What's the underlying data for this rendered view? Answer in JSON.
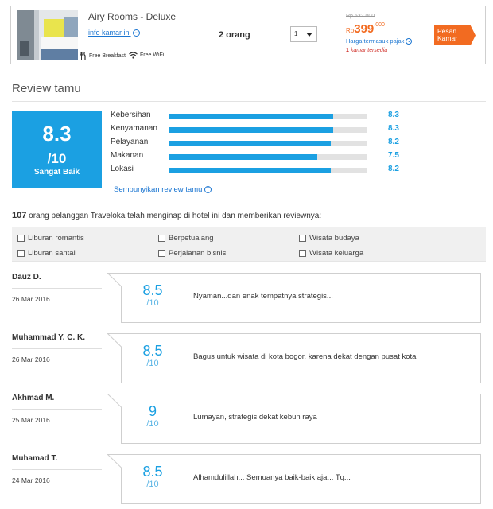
{
  "room": {
    "name": "Airy Rooms - Deluxe",
    "info_link": "info kamar ini",
    "amenities": [
      "Free Breakfast",
      "Free WiFi"
    ],
    "guests": "2 orang",
    "quantity": "1",
    "price_old": "Rp 532.000",
    "price_prefix": "Rp",
    "price_main": "399",
    "price_decimals": ".000",
    "tax_note": "Harga termasuk pajak",
    "availability_count": "1",
    "availability_text": "kamar tersedia",
    "book_label_1": "Pesan",
    "book_label_2": "Kamar",
    "accent_color": "#f26b21"
  },
  "reviews_section": {
    "title": "Review tamu",
    "overall_score": "8.3",
    "overall_max": "/10",
    "overall_label": "Sangat Baik",
    "categories": [
      {
        "label": "Kebersihan",
        "value": "8.3",
        "fraction": 0.83
      },
      {
        "label": "Kenyamanan",
        "value": "8.3",
        "fraction": 0.83
      },
      {
        "label": "Pelayanan",
        "value": "8.2",
        "fraction": 0.82
      },
      {
        "label": "Makanan",
        "value": "7.5",
        "fraction": 0.75
      },
      {
        "label": "Lokasi",
        "value": "8.2",
        "fraction": 0.82
      }
    ],
    "hide_link": "Sembunyikan review tamu",
    "summary_count": "107",
    "summary_text": "orang pelanggan Traveloka telah menginap di hotel ini dan memberikan reviewnya:",
    "filters": [
      "Liburan romantis",
      "Berpetualang",
      "Wisata budaya",
      "Liburan santai",
      "Perjalanan bisnis",
      "Wisata keluarga"
    ],
    "brand_color": "#1ba0e2"
  },
  "reviews": [
    {
      "name": "Dauz D.",
      "date": "26 Mar 2016",
      "score": "8.5",
      "max": "/10",
      "text": "Nyaman...dan enak tempatnya strategis..."
    },
    {
      "name": "Muhammad Y. C. K.",
      "date": "26 Mar 2016",
      "score": "8.5",
      "max": "/10",
      "text": "Bagus untuk wisata di kota bogor, karena dekat dengan pusat kota"
    },
    {
      "name": "Akhmad M.",
      "date": "25 Mar 2016",
      "score": "9",
      "max": "/10",
      "text": "Lumayan, strategis dekat kebun raya"
    },
    {
      "name": "Muhamad T.",
      "date": "24 Mar 2016",
      "score": "8.5",
      "max": "/10",
      "text": "Alhamdulillah... Semuanya baik-baik aja... Tq..."
    }
  ]
}
